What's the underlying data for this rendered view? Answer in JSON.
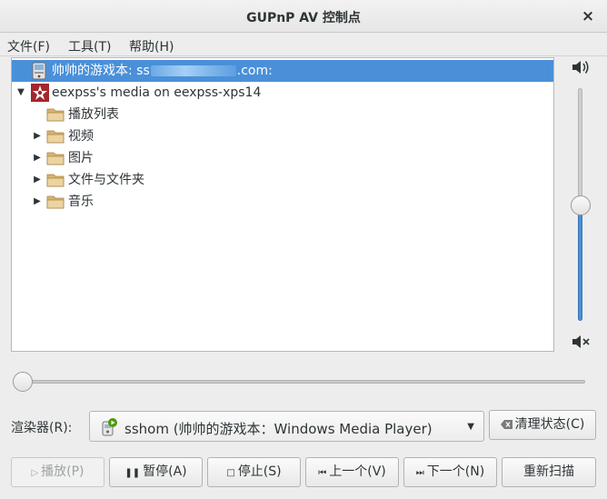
{
  "window": {
    "title": "GUPnP AV 控制点",
    "close_glyph": "×"
  },
  "menu": [
    "文件(F)",
    "工具(T)",
    "帮助(H)"
  ],
  "tree": {
    "rows": [
      {
        "label_before": "帅帅的游戏本: ss",
        "label_after": ".com:",
        "icon": "computer-icon",
        "selected": true
      },
      {
        "label": "eexpss's media on eexpss-xps14",
        "icon": "media-server-icon",
        "expanded": true
      },
      {
        "label": "播放列表",
        "icon": "folder-icon"
      },
      {
        "label": "视频",
        "icon": "folder-icon",
        "collapsed": true
      },
      {
        "label": "图片",
        "icon": "folder-icon",
        "collapsed": true
      },
      {
        "label": "文件与文件夹",
        "icon": "folder-icon",
        "collapsed": true
      },
      {
        "label": "音乐",
        "icon": "folder-icon",
        "collapsed": true
      }
    ]
  },
  "volume": {
    "level": 0.5
  },
  "seek": {
    "position": 0
  },
  "renderer": {
    "label": "渲染器(R):",
    "selected": "sshom (帅帅的游戏本：Windows Media Player)",
    "icon": "renderer-device-icon"
  },
  "buttons": {
    "clear_state": "清理状态(C)",
    "play": "播放(P)",
    "pause": "暂停(A)",
    "stop": "停止(S)",
    "previous": "上一个(V)",
    "next": "下一个(N)",
    "rescan": "重新扫描"
  },
  "colors": {
    "selection": "#4a90d9",
    "folder": "#e8c98a",
    "server_icon": "#a3262d"
  }
}
